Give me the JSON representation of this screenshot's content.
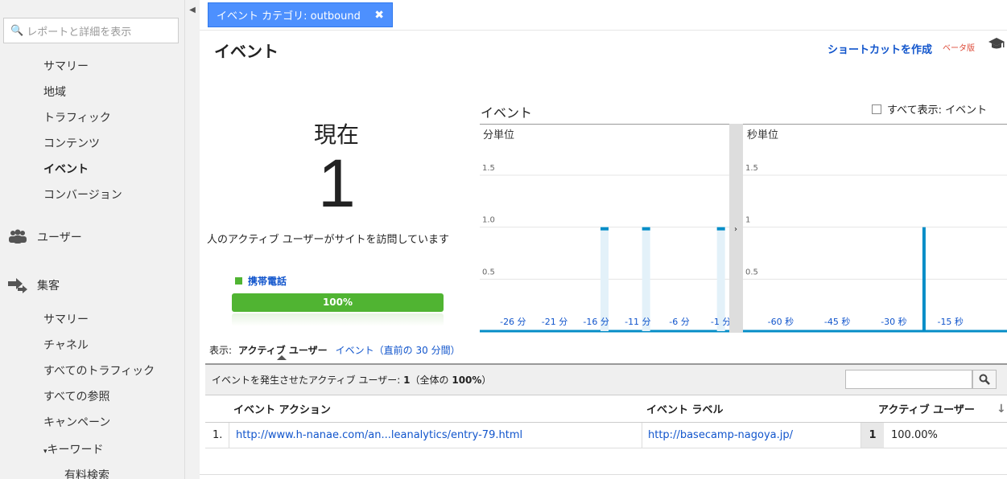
{
  "sidebar": {
    "search_placeholder": "レポートと詳細を表示",
    "realtime_items": [
      "サマリー",
      "地域",
      "トラフィック",
      "コンテンツ",
      "イベント",
      "コンバージョン"
    ],
    "users_label": "ユーザー",
    "acquisition_label": "集客",
    "acq_items": [
      "サマリー",
      "チャネル",
      "すべてのトラフィック",
      "すべての参照",
      "キャンペーン"
    ],
    "keyword_label": "キーワード",
    "paid_search": "有料検索"
  },
  "filter": {
    "label": "イベント カテゴリ: outbound",
    "close": "✖"
  },
  "header": {
    "title": "イベント",
    "shortcut": "ショートカットを作成",
    "beta": "ベータ版"
  },
  "realtime": {
    "now": "現在",
    "count": "1",
    "description": "人のアクティブ ユーザーがサイトを訪問しています",
    "device_label": "携帯電話",
    "device_pct": "100%"
  },
  "chart": {
    "title": "イベント",
    "show_all": "すべて表示: イベント"
  },
  "chart_data": [
    {
      "type": "bar",
      "title": "分単位",
      "x": [
        "-26 分",
        "-21 分",
        "-16 分",
        "-11 分",
        "-6 分",
        "-1 分"
      ],
      "ytick_labels": [
        "0.5",
        "1.0",
        "1.5"
      ],
      "ylim": [
        0,
        1.5
      ],
      "bars": [
        {
          "minute": -15,
          "value": 1
        },
        {
          "minute": -10,
          "value": 1
        },
        {
          "minute": -1,
          "value": 1
        }
      ]
    },
    {
      "type": "bar",
      "title": "秒単位",
      "x": [
        "-60 秒",
        "-45 秒",
        "-30 秒",
        "-15 秒"
      ],
      "ytick_labels": [
        "0.5",
        "1",
        "1.5"
      ],
      "ylim": [
        0,
        1.5
      ],
      "bars": [
        {
          "second": -22,
          "value": 1
        }
      ]
    }
  ],
  "view": {
    "label": "表示:",
    "active_users": "アクティブ ユーザー",
    "events_link": "イベント（直前の 30 分間）"
  },
  "table": {
    "summary_prefix": "イベントを発生させたアクティブ ユーザー:",
    "summary_count": "1",
    "summary_mid": "（全体の",
    "summary_pct": "100%",
    "summary_end": "）",
    "headers": {
      "action": "イベント アクション",
      "label": "イベント ラベル",
      "users": "アクティブ ユーザー"
    },
    "rows": [
      {
        "idx": "1.",
        "action": "http://www.h-nanae.com/an...leanalytics/entry-79.html",
        "label": "http://basecamp-nagoya.jp/",
        "count": "1",
        "pct": "100.00%"
      }
    ]
  },
  "colors": {
    "accent": "#4d90fe",
    "bar": "#058dc7",
    "mobile": "#50b432",
    "link": "#1155cc"
  }
}
